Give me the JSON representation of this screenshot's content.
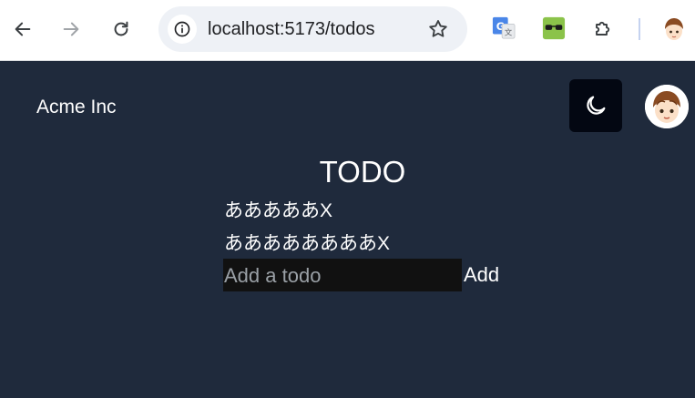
{
  "browser": {
    "url": "localhost:5173/todos",
    "icons": {
      "back": "back-arrow-icon",
      "forward": "forward-arrow-icon",
      "reload": "reload-icon",
      "info": "site-info-icon",
      "bookmark": "star-icon",
      "translate": "google-translate-icon",
      "glasses": "glasses-extension-icon",
      "extensions": "puzzle-icon",
      "profile": "profile-avatar"
    }
  },
  "header": {
    "brand": "Acme Inc",
    "theme_toggle_icon": "moon-icon",
    "avatar": "user-avatar"
  },
  "main": {
    "title": "TODO",
    "todos": [
      {
        "text": "あああああ",
        "delete_label": "X"
      },
      {
        "text": "ああああああああ",
        "delete_label": "X"
      }
    ],
    "input_placeholder": "Add a todo",
    "input_value": "",
    "add_label": "Add"
  },
  "colors": {
    "app_background": "#1f2a3c",
    "toggle_background": "#030712",
    "input_background": "#111111",
    "text": "#ffffff"
  }
}
